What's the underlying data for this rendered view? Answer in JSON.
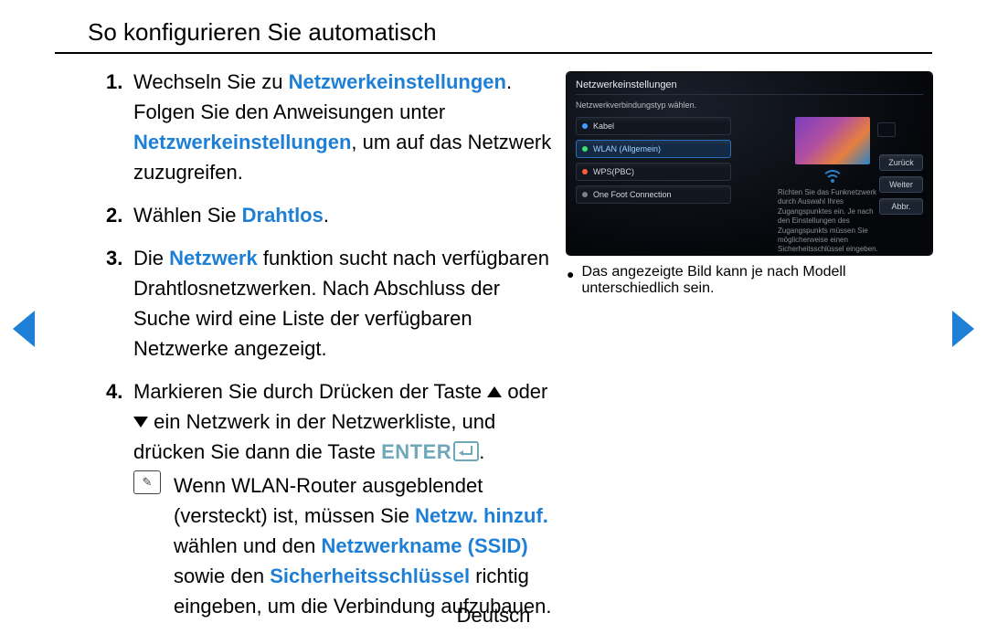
{
  "title": "So konfigurieren Sie automatisch",
  "steps": {
    "s1": {
      "t1": "Wechseln Sie zu ",
      "link1": "Netzwerkeinstellungen",
      "t2": ". Folgen Sie den Anweisungen unter ",
      "link2": "Netzwerkeinstellungen",
      "t3": ", um auf das Netzwerk zuzugreifen."
    },
    "s2": {
      "t1": "Wählen Sie ",
      "link1": "Drahtlos",
      "t2": "."
    },
    "s3": {
      "t1": "Die ",
      "link1": "Netzwerk",
      "t2": " funktion sucht nach verfügbaren Drahtlosnetzwerken. Nach Abschluss der Suche wird eine Liste der verfügbaren Netzwerke angezeigt."
    },
    "s4": {
      "t1": "Markieren Sie durch Drücken der Taste ",
      "t2": " oder ",
      "t3": " ein Netzwerk in der Netzwerkliste, und drücken Sie dann die Taste ",
      "enter": "ENTER",
      "t4": "."
    },
    "note": {
      "t1": "Wenn WLAN-Router ausgeblendet (versteckt) ist, müssen Sie ",
      "link1": "Netzw. hinzuf.",
      "t2": " wählen und den ",
      "link2": "Netzwerkname (SSID)",
      "t3": " sowie den ",
      "link3": "Sicherheitsschlüssel",
      "t4": " richtig eingeben, um die Verbindung aufzubauen."
    }
  },
  "panel": {
    "title": "Netzwerkeinstellungen",
    "subtitle": "Netzwerkverbindungstyp wählen.",
    "items": {
      "kabel": "Kabel",
      "wlan": "WLAN (Allgemein)",
      "wps": "WPS(PBC)",
      "ofc": "One Foot Connection"
    },
    "desc": "Richten Sie das Funknetzwerk durch Auswahl Ihres Zugangspunktes ein. Je nach den Einstellungen des Zugangspunkts müssen Sie möglicherweise einen Sicherheitsschlüssel eingeben.",
    "buttons": {
      "back": "Zurück",
      "next": "Weiter",
      "cancel": "Abbr."
    }
  },
  "caption": "Das angezeigte Bild kann je nach Modell unterschiedlich sein.",
  "footer": "Deutsch"
}
